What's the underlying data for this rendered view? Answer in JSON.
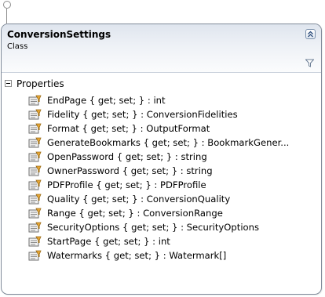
{
  "class": {
    "name": "ConversionSettings",
    "stereotype": "Class"
  },
  "icons": {
    "lollipop": "interface-lollipop-icon",
    "collapse": "double-chevron-up-icon",
    "filter": "filter-icon",
    "section_toggle": "minus-box-icon",
    "member": "property-icon"
  },
  "colors": {
    "border": "#7f8a99",
    "header_gradient_top": "#dfe5ee",
    "header_gradient_bottom": "#fbfcfd"
  },
  "sections": [
    {
      "label": "Properties",
      "members": [
        "EndPage { get; set; } : int",
        "Fidelity { get; set; } : ConversionFidelities",
        "Format { get; set; } : OutputFormat",
        "GenerateBookmarks { get; set; } : BookmarkGener...",
        "OpenPassword { get; set; } : string",
        "OwnerPassword { get; set; } : string",
        "PDFProfile { get; set; } : PDFProfile",
        "Quality { get; set; } : ConversionQuality",
        "Range { get; set; } : ConversionRange",
        "SecurityOptions { get; set; } : SecurityOptions",
        "StartPage { get; set; } : int",
        "Watermarks { get; set; } : Watermark[]"
      ]
    }
  ]
}
